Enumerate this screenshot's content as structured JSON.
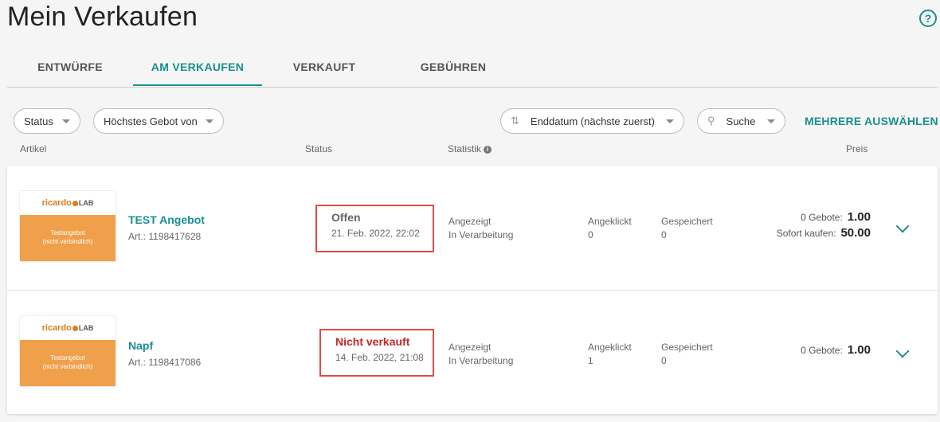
{
  "page": {
    "title": "Mein Verkaufen",
    "help_icon": "help-circle-icon"
  },
  "tabs": [
    {
      "label": "ENTWÜRFE",
      "active": false
    },
    {
      "label": "AM VERKAUFEN",
      "active": true
    },
    {
      "label": "VERKAUFT",
      "active": false
    },
    {
      "label": "GEBÜHREN",
      "active": false
    }
  ],
  "filters": {
    "status": "Status",
    "highest_bid": "Höchstes Gebot von",
    "sort": "Enddatum (nächste zuerst)",
    "search": "Suche",
    "multi_select": "MEHRERE AUSWÄHLEN"
  },
  "columns": {
    "article": "Artikel",
    "status": "Status",
    "stats": "Statistik",
    "price": "Preis"
  },
  "listings": [
    {
      "title": "TEST Angebot",
      "art_no": "Art.: 1198417628",
      "thumb_logo": "ricardo",
      "thumb_logo_suffix": "LAB",
      "thumb_line1": "Testangebot",
      "thumb_line2": "(nicht verbindlich)",
      "status": "Offen",
      "status_color": "#666666",
      "status_date": "21. Feb. 2022, 22:02",
      "shown_label": "Angezeigt",
      "shown_value": "In Verarbeitung",
      "clicked_label": "Angeklickt",
      "clicked_value": "0",
      "saved_label": "Gespeichert",
      "saved_value": "0",
      "bids_label": "0 Gebote:",
      "bids_value": "1.00",
      "buy_now_label": "Sofort kaufen:",
      "buy_now_value": "50.00"
    },
    {
      "title": "Napf",
      "art_no": "Art.: 1198417086",
      "thumb_logo": "ricardo",
      "thumb_logo_suffix": "LAB",
      "thumb_line1": "Testangebot",
      "thumb_line2": "(nicht verbindlich)",
      "status": "Nicht verkauft",
      "status_color": "#c62828",
      "status_date": "14. Feb. 2022, 21:08",
      "shown_label": "Angezeigt",
      "shown_value": "In Verarbeitung",
      "clicked_label": "Angeklickt",
      "clicked_value": "1",
      "saved_label": "Gespeichert",
      "saved_value": "0",
      "bids_label": "0 Gebote:",
      "bids_value": "1.00"
    }
  ],
  "colors": {
    "accent": "#1a8f8f",
    "highlight_border": "#e04a4a",
    "thumb_banner": "#f0a04b"
  }
}
